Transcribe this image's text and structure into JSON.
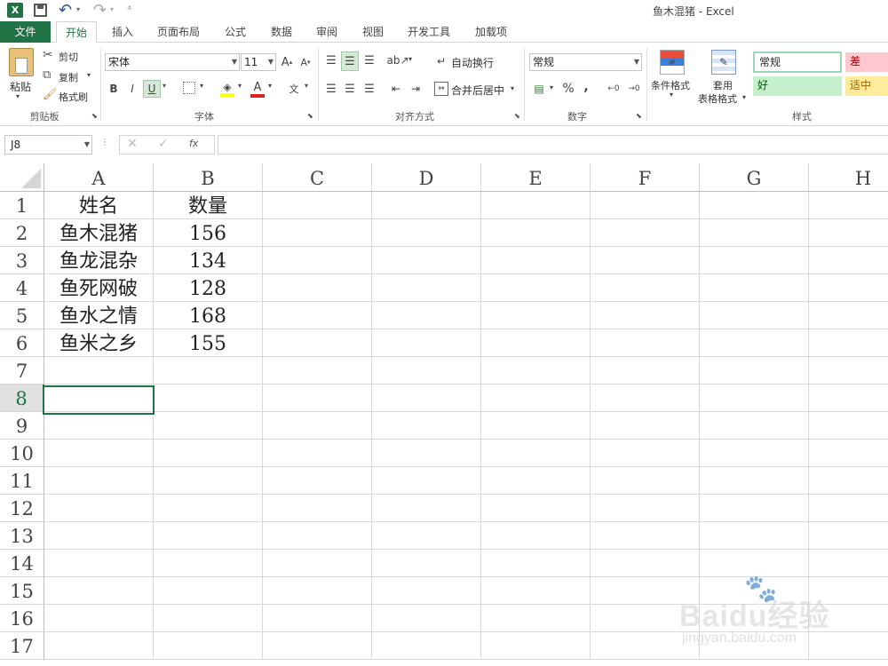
{
  "window": {
    "title": "鱼木混猪 - Excel"
  },
  "quick_access": {
    "app_icon": "excel-icon",
    "save_icon": "save-icon",
    "undo_icon": "undo-icon",
    "redo_icon": "redo-icon",
    "customize_icon": "customize-icon"
  },
  "tabs": [
    {
      "label": "文件"
    },
    {
      "label": "开始"
    },
    {
      "label": "插入"
    },
    {
      "label": "页面布局"
    },
    {
      "label": "公式"
    },
    {
      "label": "数据"
    },
    {
      "label": "审阅"
    },
    {
      "label": "视图"
    },
    {
      "label": "开发工具"
    },
    {
      "label": "加载项"
    }
  ],
  "ribbon": {
    "clipboard": {
      "paste_label": "粘贴",
      "cut_label": "剪切",
      "copy_label": "复制",
      "format_painter_label": "格式刷",
      "group_label": "剪贴板"
    },
    "font": {
      "font_name": "宋体",
      "font_size": "11",
      "bold": "B",
      "italic": "I",
      "underline": "U",
      "group_label": "字体"
    },
    "alignment": {
      "wrap_text_label": "自动换行",
      "merge_center_label": "合并后居中",
      "group_label": "对齐方式"
    },
    "number": {
      "format": "常规",
      "percent": "%",
      "comma": ",",
      "group_label": "数字"
    },
    "styles": {
      "conditional_formatting_label": "条件格式",
      "format_as_table_label_1": "套用",
      "format_as_table_label_2": "表格格式",
      "normal": "常规",
      "bad": "差",
      "good": "好",
      "neutral": "适中",
      "group_label": "样式"
    }
  },
  "formula_bar": {
    "name_box": "J8",
    "fx": "fx",
    "formula": ""
  },
  "sheet": {
    "columns": [
      "A",
      "B",
      "C",
      "D",
      "E",
      "F",
      "G",
      "H"
    ],
    "rows": [
      "1",
      "2",
      "3",
      "4",
      "5",
      "6",
      "7",
      "8",
      "9",
      "10",
      "11",
      "12",
      "13",
      "14",
      "15",
      "16",
      "17"
    ],
    "cells": [
      [
        "姓名",
        "数量"
      ],
      [
        "鱼木混猪",
        "156"
      ],
      [
        "鱼龙混杂",
        "134"
      ],
      [
        "鱼死网破",
        "128"
      ],
      [
        "鱼水之情",
        "168"
      ],
      [
        "鱼米之乡",
        "155"
      ]
    ]
  },
  "watermark": {
    "text": "Baidu经验",
    "url_text": "jingyan.baidu.com"
  },
  "colors": {
    "excel_green": "#217346",
    "bad_fill": "#ffc7ce",
    "good_fill": "#c6efce",
    "neutral_fill": "#ffeb9c"
  }
}
